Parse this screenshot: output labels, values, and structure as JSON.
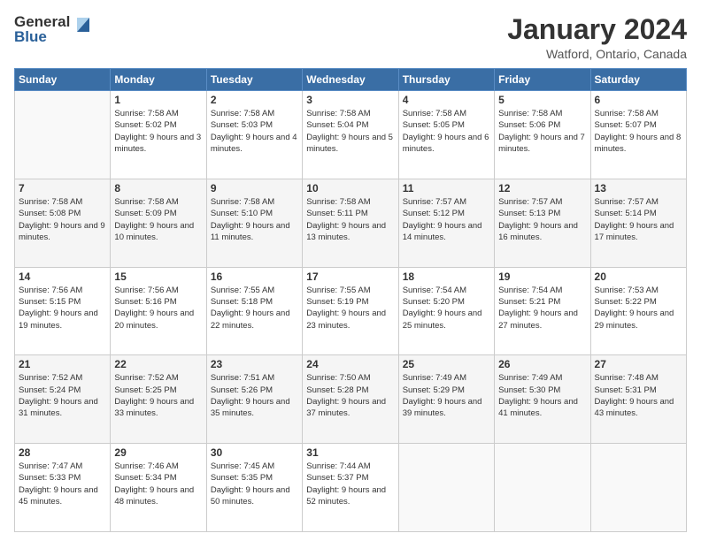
{
  "logo": {
    "general": "General",
    "blue": "Blue"
  },
  "header": {
    "title": "January 2024",
    "location": "Watford, Ontario, Canada"
  },
  "days_of_week": [
    "Sunday",
    "Monday",
    "Tuesday",
    "Wednesday",
    "Thursday",
    "Friday",
    "Saturday"
  ],
  "weeks": [
    [
      {
        "day": "",
        "info": ""
      },
      {
        "day": "1",
        "sunrise": "7:58 AM",
        "sunset": "5:02 PM",
        "daylight": "9 hours and 3 minutes."
      },
      {
        "day": "2",
        "sunrise": "7:58 AM",
        "sunset": "5:03 PM",
        "daylight": "9 hours and 4 minutes."
      },
      {
        "day": "3",
        "sunrise": "7:58 AM",
        "sunset": "5:04 PM",
        "daylight": "9 hours and 5 minutes."
      },
      {
        "day": "4",
        "sunrise": "7:58 AM",
        "sunset": "5:05 PM",
        "daylight": "9 hours and 6 minutes."
      },
      {
        "day": "5",
        "sunrise": "7:58 AM",
        "sunset": "5:06 PM",
        "daylight": "9 hours and 7 minutes."
      },
      {
        "day": "6",
        "sunrise": "7:58 AM",
        "sunset": "5:07 PM",
        "daylight": "9 hours and 8 minutes."
      }
    ],
    [
      {
        "day": "7",
        "sunrise": "7:58 AM",
        "sunset": "5:08 PM",
        "daylight": "9 hours and 9 minutes."
      },
      {
        "day": "8",
        "sunrise": "7:58 AM",
        "sunset": "5:09 PM",
        "daylight": "9 hours and 10 minutes."
      },
      {
        "day": "9",
        "sunrise": "7:58 AM",
        "sunset": "5:10 PM",
        "daylight": "9 hours and 11 minutes."
      },
      {
        "day": "10",
        "sunrise": "7:58 AM",
        "sunset": "5:11 PM",
        "daylight": "9 hours and 13 minutes."
      },
      {
        "day": "11",
        "sunrise": "7:57 AM",
        "sunset": "5:12 PM",
        "daylight": "9 hours and 14 minutes."
      },
      {
        "day": "12",
        "sunrise": "7:57 AM",
        "sunset": "5:13 PM",
        "daylight": "9 hours and 16 minutes."
      },
      {
        "day": "13",
        "sunrise": "7:57 AM",
        "sunset": "5:14 PM",
        "daylight": "9 hours and 17 minutes."
      }
    ],
    [
      {
        "day": "14",
        "sunrise": "7:56 AM",
        "sunset": "5:15 PM",
        "daylight": "9 hours and 19 minutes."
      },
      {
        "day": "15",
        "sunrise": "7:56 AM",
        "sunset": "5:16 PM",
        "daylight": "9 hours and 20 minutes."
      },
      {
        "day": "16",
        "sunrise": "7:55 AM",
        "sunset": "5:18 PM",
        "daylight": "9 hours and 22 minutes."
      },
      {
        "day": "17",
        "sunrise": "7:55 AM",
        "sunset": "5:19 PM",
        "daylight": "9 hours and 23 minutes."
      },
      {
        "day": "18",
        "sunrise": "7:54 AM",
        "sunset": "5:20 PM",
        "daylight": "9 hours and 25 minutes."
      },
      {
        "day": "19",
        "sunrise": "7:54 AM",
        "sunset": "5:21 PM",
        "daylight": "9 hours and 27 minutes."
      },
      {
        "day": "20",
        "sunrise": "7:53 AM",
        "sunset": "5:22 PM",
        "daylight": "9 hours and 29 minutes."
      }
    ],
    [
      {
        "day": "21",
        "sunrise": "7:52 AM",
        "sunset": "5:24 PM",
        "daylight": "9 hours and 31 minutes."
      },
      {
        "day": "22",
        "sunrise": "7:52 AM",
        "sunset": "5:25 PM",
        "daylight": "9 hours and 33 minutes."
      },
      {
        "day": "23",
        "sunrise": "7:51 AM",
        "sunset": "5:26 PM",
        "daylight": "9 hours and 35 minutes."
      },
      {
        "day": "24",
        "sunrise": "7:50 AM",
        "sunset": "5:28 PM",
        "daylight": "9 hours and 37 minutes."
      },
      {
        "day": "25",
        "sunrise": "7:49 AM",
        "sunset": "5:29 PM",
        "daylight": "9 hours and 39 minutes."
      },
      {
        "day": "26",
        "sunrise": "7:49 AM",
        "sunset": "5:30 PM",
        "daylight": "9 hours and 41 minutes."
      },
      {
        "day": "27",
        "sunrise": "7:48 AM",
        "sunset": "5:31 PM",
        "daylight": "9 hours and 43 minutes."
      }
    ],
    [
      {
        "day": "28",
        "sunrise": "7:47 AM",
        "sunset": "5:33 PM",
        "daylight": "9 hours and 45 minutes."
      },
      {
        "day": "29",
        "sunrise": "7:46 AM",
        "sunset": "5:34 PM",
        "daylight": "9 hours and 48 minutes."
      },
      {
        "day": "30",
        "sunrise": "7:45 AM",
        "sunset": "5:35 PM",
        "daylight": "9 hours and 50 minutes."
      },
      {
        "day": "31",
        "sunrise": "7:44 AM",
        "sunset": "5:37 PM",
        "daylight": "9 hours and 52 minutes."
      },
      {
        "day": "",
        "info": ""
      },
      {
        "day": "",
        "info": ""
      },
      {
        "day": "",
        "info": ""
      }
    ]
  ]
}
